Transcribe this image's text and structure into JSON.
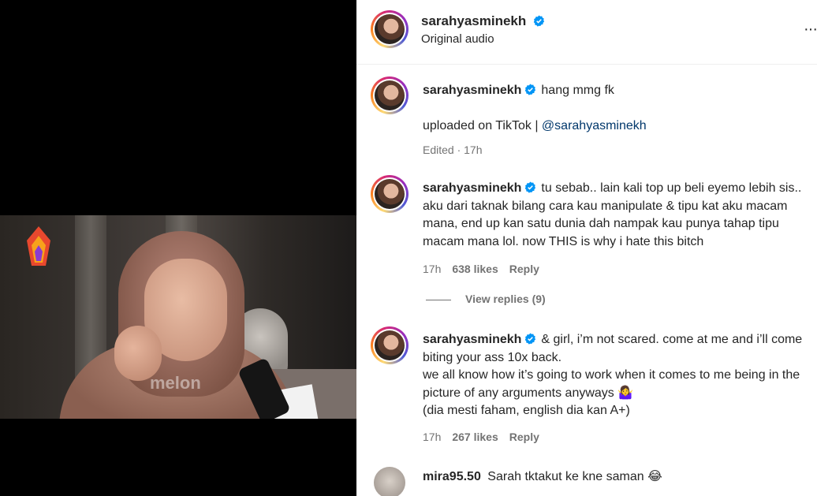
{
  "video": {
    "watermark": "melon"
  },
  "header": {
    "username": "sarahyasminekh",
    "subtitle": "Original audio",
    "more_label": "···"
  },
  "caption": {
    "username": "sarahyasminekh",
    "text": "hang mmg fk",
    "line2_prefix": "uploaded on TikTok | ",
    "mention": "@sarahyasminekh",
    "meta": "Edited · 17h"
  },
  "comments": [
    {
      "username": "sarahyasminekh",
      "verified": true,
      "text": "tu sebab.. lain kali top up beli eyemo lebih sis.. aku dari taknak bilang cara kau manipulate & tipu kat aku macam mana, end up kan satu dunia dah nampak kau punya tahap tipu macam mana lol. now THIS is why i hate this bitch",
      "time": "17h",
      "likes": "638 likes",
      "reply": "Reply",
      "view_replies": "View replies (9)"
    },
    {
      "username": "sarahyasminekh",
      "verified": true,
      "text_lines": [
        "& girl, i’m not scared. come at me and i’ll come biting your ass 10x back.",
        "we all know how it’s going to work when it comes to me being in the picture of any arguments anyways 🤷‍♀️",
        "(dia mesti faham, english dia kan A+)"
      ],
      "time": "17h",
      "likes": "267 likes",
      "reply": "Reply"
    },
    {
      "username": "mira95.50",
      "verified": false,
      "text": "Sarah tktakut ke kne saman 😂"
    }
  ],
  "colors": {
    "verified": "#0095f6",
    "link": "#00376b",
    "muted": "#737373"
  }
}
